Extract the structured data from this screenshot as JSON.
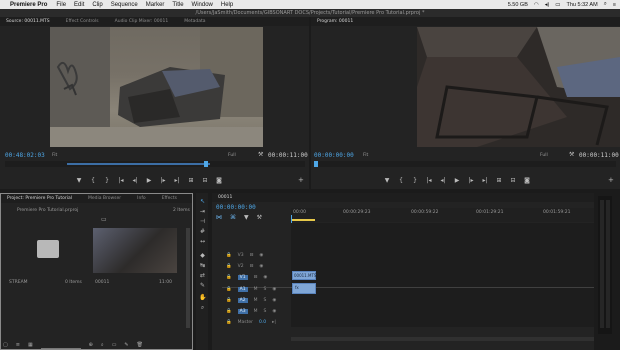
{
  "menubar": {
    "app": "Premiere Pro",
    "items": [
      "File",
      "Edit",
      "Clip",
      "Sequence",
      "Marker",
      "Title",
      "Window",
      "Help"
    ],
    "battery": "5.50 GB",
    "time": "Thu 5:32 AM"
  },
  "path": "/Users/JaSmith/Documents/GIBSONART DOCS/Projects/Tutorial/Premiere Pro Tutorial.prproj *",
  "source": {
    "tabs": [
      "Source: 00011.MTS",
      "Effect Controls",
      "Audio Clip Mixer: 00011",
      "Metadata"
    ],
    "timecode_left": "00:48:02:03",
    "timecode_right": "00:00:11:00",
    "fit": "Fit",
    "quality": "Full"
  },
  "program": {
    "tabs": [
      "Program: 00011"
    ],
    "timecode_left": "00:00:00:00",
    "timecode_right": "00:00:11:00",
    "fit": "Fit",
    "quality": "Full"
  },
  "project": {
    "tabs": [
      "Project: Premiere Pro Tutorial",
      "Media Browser",
      "Info",
      "Effects"
    ],
    "file": "Premiere Pro Tutorial.prproj",
    "count": "2 Items",
    "items": [
      {
        "name": "STREAM",
        "meta": "0 Items"
      },
      {
        "name": "00011",
        "meta": "11:00"
      }
    ]
  },
  "timeline": {
    "tab": "00011",
    "timecode": "00:00:00:00",
    "ruler": [
      "00:00",
      "00:00:29:23",
      "00:00:59:22",
      "00:01:29:21",
      "00:01:59:21"
    ],
    "tracks": [
      "V3",
      "V2",
      "V1",
      "A1",
      "A2",
      "A3"
    ],
    "master": "Master",
    "master_value": "0.0",
    "clip_video": "00011.MTS",
    "clip_audio": "fx"
  }
}
